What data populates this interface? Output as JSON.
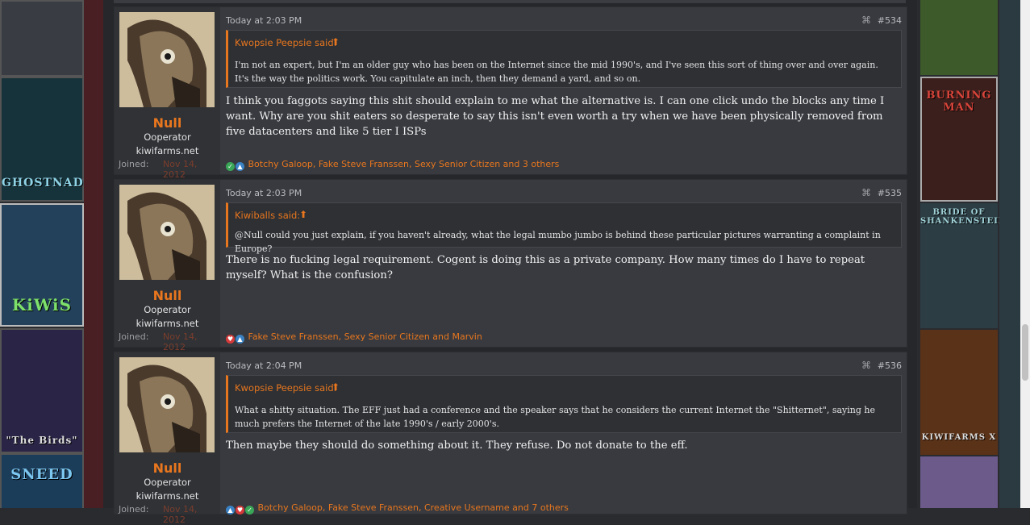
{
  "posts": [
    {
      "user": {
        "name": "Null",
        "title": "Ooperator",
        "site": "kiwifarms.net",
        "joined_label": "Joined:",
        "joined_date": "Nov 14, 2012"
      },
      "timestamp": "Today at 2:03 PM",
      "post_number": "#534",
      "quote": {
        "author": "Kwopsie Peepsie said:",
        "text": "I'm not an expert, but I'm an older guy who has been on the Internet since the mid 1990's, and I've seen this sort of thing over and over again. It's the way the politics work. You capitulate an inch, then they demand a yard, and so on."
      },
      "message": "I think you faggots saying this shit should explain to me what the alternative is. I can one click undo the blocks any time I want. Why are you shit eaters so desperate to say this isn't even worth a try when we have been physically removed from five datacenters and like 5 tier I ISPs",
      "reactions": "Botchy Galoop, Fake Steve Franssen, Sexy Senior Citizen and 3 others"
    },
    {
      "user": {
        "name": "Null",
        "title": "Ooperator",
        "site": "kiwifarms.net",
        "joined_label": "Joined:",
        "joined_date": "Nov 14, 2012"
      },
      "timestamp": "Today at 2:03 PM",
      "post_number": "#535",
      "quote": {
        "author": "Kiwiballs said:",
        "text": "@Null could you just explain, if you haven't already, what the legal mumbo jumbo is behind these particular pictures warranting a complaint in Europe?"
      },
      "message": "There is no fucking legal requirement. Cogent is doing this as a private company. How many times do I have to repeat myself? What is the confusion?",
      "reactions": "Fake Steve Franssen, Sexy Senior Citizen and Marvin"
    },
    {
      "user": {
        "name": "Null",
        "title": "Ooperator",
        "site": "kiwifarms.net",
        "joined_label": "Joined:",
        "joined_date": "Nov 14, 2012"
      },
      "timestamp": "Today at 2:04 PM",
      "post_number": "#536",
      "quote": {
        "author": "Kwopsie Peepsie said:",
        "text": "What a shitty situation. The EFF just had a conference and the speaker says that he considers the current Internet the \"Shitternet\", saying he much prefers the Internet of the late 1990's / early 2000's."
      },
      "message": "Then maybe they should do something about it. They refuse. Do not donate to the eff.",
      "reactions": "Botchy Galoop, Fake Steve Franssen, Creative Username and 7 others"
    }
  ],
  "background": {
    "left_tiles": [
      "GHOSTNADO",
      "KiWiS",
      "\"The Birds\"",
      "SNEED"
    ],
    "right_tiles": [
      "BURNING MAN",
      "BRIDE OF SHANKENSTEIN",
      "KIWIFARMS X"
    ]
  },
  "icons": {
    "share": "share-icon",
    "quote_jump": "arrow-up-circle-icon"
  },
  "colors": {
    "accent": "#e8761e",
    "post_bg": "#383a3f",
    "page_bg": "#26272b"
  }
}
